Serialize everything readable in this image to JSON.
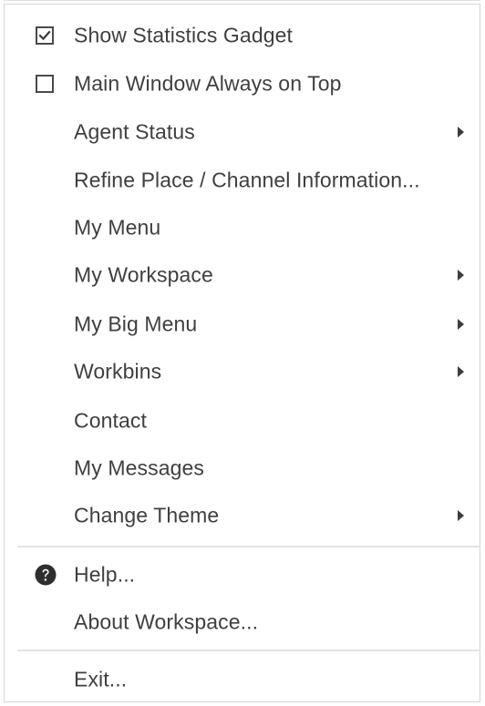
{
  "menu": {
    "items": [
      {
        "label": "Show Statistics Gadget",
        "type": "checkbox",
        "checked": true
      },
      {
        "label": "Main Window Always on Top",
        "type": "checkbox",
        "checked": false
      },
      {
        "label": "Agent Status",
        "type": "submenu"
      },
      {
        "label": "Refine Place / Channel Information...",
        "type": "action"
      },
      {
        "label": "My Menu",
        "type": "action"
      },
      {
        "label": "My Workspace",
        "type": "submenu"
      },
      {
        "label": "My Big Menu",
        "type": "submenu"
      },
      {
        "label": "Workbins",
        "type": "submenu"
      },
      {
        "label": "Contact",
        "type": "action"
      },
      {
        "label": "My Messages",
        "type": "action"
      },
      {
        "label": "Change Theme",
        "type": "submenu"
      }
    ],
    "help": {
      "label": "Help...",
      "icon": "question-circle-icon"
    },
    "about": {
      "label": "About Workspace..."
    },
    "exit": {
      "label": "Exit..."
    }
  }
}
